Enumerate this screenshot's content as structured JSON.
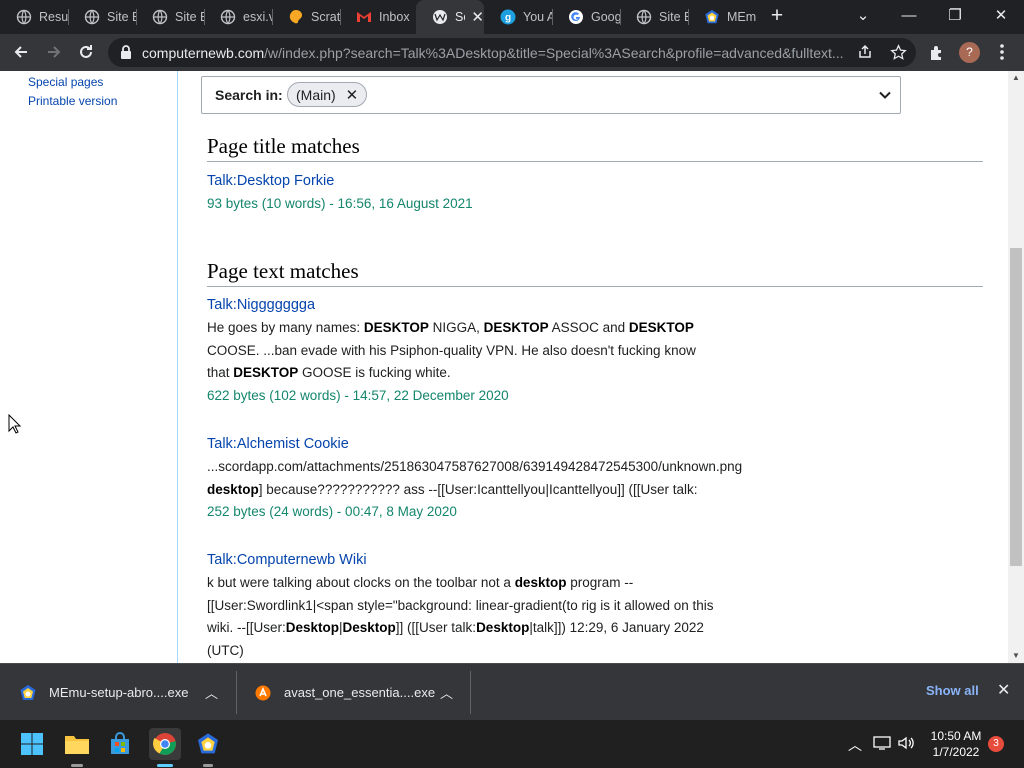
{
  "browser": {
    "tabs": [
      {
        "title": "Resu",
        "icon": "globe-icon"
      },
      {
        "title": "Site E",
        "icon": "globe-icon"
      },
      {
        "title": "Site E",
        "icon": "globe-icon"
      },
      {
        "title": "esxi.v",
        "icon": "globe-icon"
      },
      {
        "title": "Scrat",
        "icon": "scratch-icon"
      },
      {
        "title": "Inbox",
        "icon": "gmail-icon"
      },
      {
        "title": "Se",
        "icon": "wiki-icon",
        "active": true
      },
      {
        "title": "You A",
        "icon": "g-icon"
      },
      {
        "title": "Goog",
        "icon": "google-icon"
      },
      {
        "title": "Site E",
        "icon": "globe-icon"
      },
      {
        "title": "MEm",
        "icon": "memu-icon"
      }
    ],
    "url_host": "computernewb.com",
    "url_path": "/w/index.php?search=Talk%3ADesktop&title=Special%3ASearch&profile=advanced&fulltext...",
    "profile_initial": "?"
  },
  "sidebar": {
    "links": [
      "Special pages",
      "Printable version"
    ]
  },
  "search_in": {
    "label": "Search in:",
    "chip": "(Main)"
  },
  "title_matches": {
    "heading": "Page title matches",
    "results": [
      {
        "title": "Talk:Desktop Forkie",
        "meta": "93 bytes (10 words) - 16:56, 16 August 2021"
      }
    ]
  },
  "text_matches": {
    "heading": "Page text matches",
    "results": [
      {
        "title": "Talk:Niggggggga",
        "lines": [
          [
            [
              "He goes by many names: ",
              false
            ],
            [
              "DESKTOP",
              true
            ],
            [
              " NIGGA, ",
              false
            ],
            [
              "DESKTOP",
              true
            ],
            [
              " ASSOC and ",
              false
            ],
            [
              "DESKTOP",
              true
            ]
          ],
          [
            [
              "COOSE. ...ban evade with his Psiphon-quality VPN. He also doesn't fucking know",
              false
            ]
          ],
          [
            [
              "that ",
              false
            ],
            [
              "DESKTOP",
              true
            ],
            [
              " GOOSE is fucking white.",
              false
            ]
          ]
        ],
        "meta": "622 bytes (102 words) - 14:57, 22 December 2020"
      },
      {
        "title": "Talk:Alchemist Cookie",
        "lines": [
          [
            [
              "...scordapp.com/attachments/251863047587627008/639149428472545300/unknown.png",
              false
            ]
          ],
          [
            [
              "desktop",
              true
            ],
            [
              "] because??????????? ass --[[User:Icanttellyou|Icanttellyou]] ([[User talk:",
              false
            ]
          ]
        ],
        "meta": "252 bytes (24 words) - 00:47, 8 May 2020"
      },
      {
        "title": "Talk:Computernewb Wiki",
        "lines": [
          [
            [
              "k but were talking about clocks on the toolbar not a ",
              false
            ],
            [
              "desktop",
              true
            ],
            [
              " program --",
              false
            ]
          ],
          [
            [
              "[[User:Swordlink1|<span style=\"background: linear-gradient(to rig is it allowed on this",
              false
            ]
          ],
          [
            [
              "wiki. --[[User:",
              false
            ],
            [
              "Desktop",
              true
            ],
            [
              "|",
              false
            ],
            [
              "Desktop",
              true
            ],
            [
              "]] ([[User talk:",
              false
            ],
            [
              "Desktop",
              true
            ],
            [
              "|talk]]) 12:29, 6 January 2022",
              false
            ]
          ],
          [
            [
              "(UTC)",
              false
            ]
          ]
        ],
        "meta": ""
      }
    ]
  },
  "downloads": {
    "items": [
      {
        "name": "MEmu-setup-abro....exe",
        "icon": "memu-icon"
      },
      {
        "name": "avast_one_essentia....exe",
        "icon": "avast-icon"
      }
    ],
    "show_all": "Show all"
  },
  "taskbar": {
    "time": "10:50 AM",
    "date": "1/7/2022",
    "notifications": "3"
  }
}
